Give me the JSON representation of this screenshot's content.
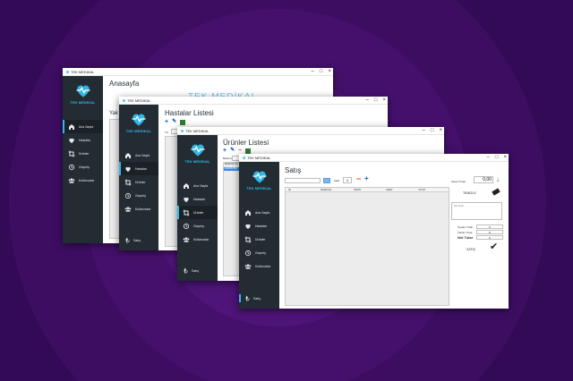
{
  "app": {
    "name": "TEK MEDIKAL",
    "logo_text": "TEK MEDİKAL",
    "accent": "#2fb8e8"
  },
  "menu": [
    {
      "label": "Ana Sayfa",
      "icon": "home-icon"
    },
    {
      "label": "Hastalar",
      "icon": "heart-icon"
    },
    {
      "label": "Ürünler",
      "icon": "crop-icon"
    },
    {
      "label": "Geçmiş",
      "icon": "history-icon"
    },
    {
      "label": "Kullanıcılar",
      "icon": "users-icon"
    }
  ],
  "footer": {
    "label": "Satış",
    "icon": "lira-icon"
  },
  "window1": {
    "title": "Anasayfa",
    "watermark": "TEK MEDİKAL",
    "subheading": "Yak"
  },
  "window2": {
    "title": "Hastalar Listesi",
    "search_label": "TC"
  },
  "window3": {
    "title": "Ürünler Listesi",
    "search_label": "Barkod",
    "table_header": "BARKOD NO",
    "selected_row": "1234567890"
  },
  "window4": {
    "title": "Satış",
    "adet_label": "Adet",
    "adet_value": "1",
    "columns": [
      "ID",
      "BARKOD",
      "ÜRÜN",
      "ADET",
      "FİYAT"
    ],
    "sepet_label": "Sepet Tutarı",
    "sepet_value": "0,00",
    "temizle_label": "TEMİZLE",
    "notes_placeholder": "Not Girin",
    "toplam_label": "Toplam Tutar",
    "toplam_value": "0",
    "indirim_label": "İndirim Tutar",
    "indirim_value": "0",
    "net_label": "Net Tutar",
    "net_value": "0",
    "satis_label": "SATIŞ"
  }
}
